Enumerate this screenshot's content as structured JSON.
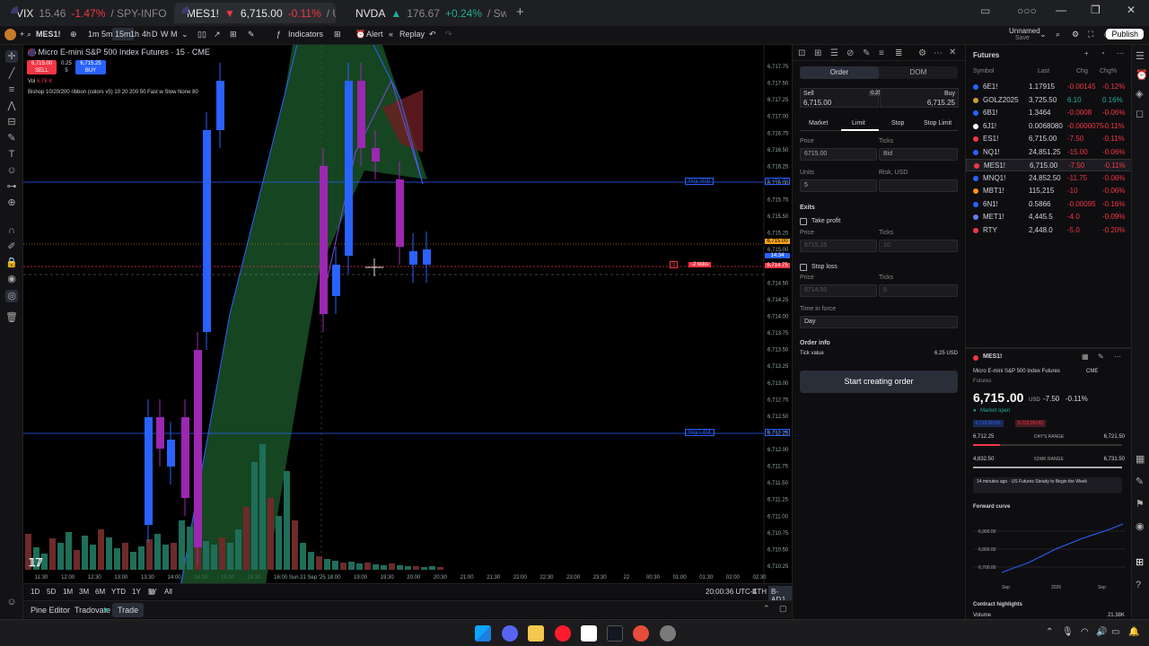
{
  "browser_tabs": [
    {
      "symbol": "VIX",
      "price": "15.46",
      "change": "-1.47%",
      "suffix": "/ SPY-INFO"
    },
    {
      "symbol": "MES1!",
      "price": "6,715.00",
      "change": "-0.11%",
      "suffix": "/ U"
    },
    {
      "symbol": "NVDA",
      "price": "176.67",
      "change": "+0.24%",
      "suffix": "/ Sw"
    }
  ],
  "toolbar": {
    "symbol": "MES1!",
    "intervals": [
      "1m",
      "5m",
      "15m",
      "1h",
      "4h",
      "D",
      "W",
      "M"
    ],
    "indicators": "Indicators",
    "alert": "Alert",
    "replay": "Replay",
    "layout_name": "Unnamed",
    "layout_sub": "Save",
    "publish": "Publish"
  },
  "chart": {
    "title": "Micro E-mini S&P 500 Index Futures · 15 · CME",
    "sell_price": "6,715.00",
    "sell_label": "SELL",
    "spread": "0.25",
    "spread_unit": "5",
    "buy_price": "6,715.25",
    "buy_label": "BUY",
    "vol_label": "Vol",
    "vol_value": "6.78 K",
    "indicator_line": "Bishop 10/20/200 ribbon (colors v5) 10 20 200 50 Fast w Slow None 80",
    "price_ticks": [
      "6,717.75",
      "6,717.50",
      "6,717.25",
      "6,717.00",
      "6,716.75",
      "6,716.50",
      "6,716.25",
      "6,716.00",
      "6,715.75",
      "6,715.50",
      "6,715.25",
      "6,715.00",
      "6,714.75",
      "6,714.50",
      "6,714.25",
      "6,714.00",
      "6,713.75",
      "6,713.50",
      "6,713.25",
      "6,713.00",
      "6,712.75",
      "6,712.50",
      "6,712.25",
      "6,712.00",
      "6,711.75",
      "6,711.50",
      "6,711.25",
      "6,711.00",
      "6,710.75",
      "6,710.50",
      "6,710.25"
    ],
    "time_ticks": [
      "11:30",
      "12:00",
      "12:30",
      "13:00",
      "13:30",
      "14:00",
      "14:30",
      "15:00",
      "15:30",
      "16:00",
      "Sun 21 Sep '25",
      "18:00",
      "19:00",
      "19:30",
      "20:00",
      "20:30",
      "21:00",
      "21:30",
      "22:00",
      "22:30",
      "23:00",
      "23:30",
      "22",
      "00:30",
      "01:00",
      "01:30",
      "02:00",
      "02:30"
    ],
    "buy_stop_label": "Buy Stop",
    "buy_limit_label": "Buy Limit",
    "ticks_label": "-2 ticks",
    "pos_qty": "5",
    "last_price_tag": "6,715.00",
    "sell_tag": "6,714.75",
    "countdown": "14:34",
    "crosshair_price": "6,714.50",
    "buy_stop_price": "6,716.00",
    "buy_limit_price": "6,712.50",
    "bottom_ranges": [
      "1D",
      "5D",
      "1M",
      "3M",
      "6M",
      "YTD",
      "1Y",
      "5Y",
      "All"
    ],
    "clock": "20:00:36 UTC-4",
    "eth": "ETH",
    "badj": "B-ADJ",
    "panel_tabs": [
      "Pine Editor",
      "Tradovate",
      "Trade"
    ]
  },
  "order_panel": {
    "tabs": [
      "Order",
      "DOM"
    ],
    "sell_label": "Sell",
    "sell_value": "6,715.00",
    "spread": "0.25",
    "buy_label": "Buy",
    "buy_value": "6,715.25",
    "type_tabs": [
      "Market",
      "Limit",
      "Stop",
      "Stop Limit"
    ],
    "price_label": "Price",
    "price_value": "6715.00",
    "ticks_label": "Ticks",
    "ticks_value": "Bid",
    "units_label": "Units",
    "units_value": "5",
    "risk_label": "Risk, USD",
    "exits_label": "Exits",
    "take_profit": "Take profit",
    "tp_price": "6715.25",
    "tp_ticks": "10",
    "stop_loss": "Stop loss",
    "sl_price": "6714.50",
    "sl_ticks": "5",
    "tif_label": "Time in force",
    "tif_value": "Day",
    "order_info": "Order info",
    "tick_value_label": "Tick value",
    "tick_value": "6.25 USD",
    "submit": "Start creating order"
  },
  "watchlist": {
    "title": "Futures",
    "headers": [
      "Symbol",
      "Last",
      "Chg",
      "Chg%"
    ],
    "rows": [
      {
        "sym": "6E1!",
        "last": "1.17915",
        "chg": "-0.00145",
        "pct": "-0.12%",
        "dir": "neg",
        "color": "#2962ff"
      },
      {
        "sym": "GOLZ2025",
        "last": "3,725.50",
        "chg": "6.10",
        "pct": "0.16%",
        "dir": "pos",
        "color": "#c9a227"
      },
      {
        "sym": "6B1!",
        "last": "1.3464",
        "chg": "-0.0008",
        "pct": "-0.06%",
        "dir": "neg",
        "color": "#2962ff"
      },
      {
        "sym": "6J1!",
        "last": "0.0068080",
        "chg": "-0.0000075",
        "pct": "-0.11%",
        "dir": "neg",
        "color": "#ffffff"
      },
      {
        "sym": "ES1!",
        "last": "6,715.00",
        "chg": "-7.50",
        "pct": "-0.11%",
        "dir": "neg",
        "color": "#f23645"
      },
      {
        "sym": "NQ1!",
        "last": "24,851.25",
        "chg": "-15.00",
        "pct": "-0.06%",
        "dir": "neg",
        "color": "#2962ff"
      },
      {
        "sym": "MES1!",
        "last": "6,715.00",
        "chg": "-7.50",
        "pct": "-0.11%",
        "dir": "neg",
        "color": "#f23645"
      },
      {
        "sym": "MNQ1!",
        "last": "24,852.50",
        "chg": "-11.75",
        "pct": "-0.06%",
        "dir": "neg",
        "color": "#2962ff"
      },
      {
        "sym": "MBT1!",
        "last": "115,215",
        "chg": "-10",
        "pct": "-0.06%",
        "dir": "neg",
        "color": "#f7931a"
      },
      {
        "sym": "6N1!",
        "last": "0.5866",
        "chg": "-0.00095",
        "pct": "-0.16%",
        "dir": "neg",
        "color": "#2962ff"
      },
      {
        "sym": "MET1!",
        "last": "4,445.5",
        "chg": "-4.0",
        "pct": "-0.09%",
        "dir": "neg",
        "color": "#627eea"
      },
      {
        "sym": "RTY",
        "last": "2,448.0",
        "chg": "-5.0",
        "pct": "-0.20%",
        "dir": "neg",
        "color": "#f23645"
      }
    ]
  },
  "details": {
    "symbol": "MES1!",
    "name": "Micro E-mini S&P 500 Index Futures",
    "exchange": "CME",
    "category": "Futures",
    "price_main": "6,715",
    "price_dec": ".00",
    "currency": "USD",
    "change": "-7.50",
    "change_pct": "-0.11%",
    "status": "Market open",
    "pill_sell": "6,715.00×51",
    "pill_buy": "6,715.25×53",
    "days_low": "6,712.25",
    "days_label": "DAY'S RANGE",
    "days_high": "6,721.50",
    "week_low": "4,832.50",
    "week_label": "52WK RANGE",
    "week_high": "6,731.50",
    "news": "14 minutes ago · US Futures Steady to Begin the Week",
    "forward_curve": "Forward curve",
    "curve_ticks": [
      "6,900.00",
      "6,800.00",
      "6,700.00"
    ],
    "curve_x": [
      "Sep",
      "2026",
      "Sep"
    ],
    "contract_highlights": "Contract highlights",
    "volume_label": "Volume",
    "volume_value": "21.38K"
  },
  "colors": {
    "up": "#2962ff",
    "down": "#9c27b0",
    "sell": "#f23645",
    "buy": "#2962ff",
    "positive": "#22ab94"
  }
}
